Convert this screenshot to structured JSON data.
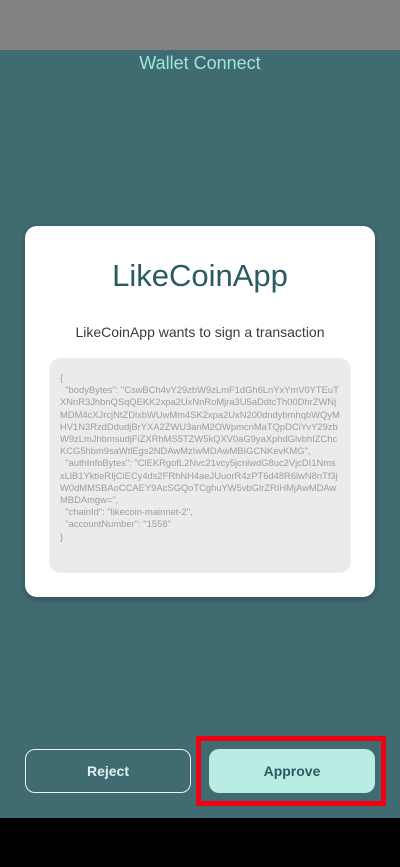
{
  "header": {
    "title": "Wallet Connect"
  },
  "card": {
    "app_name": "LikeCoinApp",
    "subtitle": "LikeCoinApp wants to sign a transaction",
    "payload": "{\n  \"bodyBytes\": \"CswBCh4vY29zbW9zLmF1dGh6LnYxYmV0YTEuTXNnR3JhbnQSqQEKK2xpa2UxNnRoMjra3U5aDdtcTh00DhrZWNjMDM4cXJrcjNtZDlxbWUwMm4SK2xpa2UxN200dndybmhqbWQyMHV1N3RzdDdudjBrYXA2ZWU3anM2OWpmcnMaTQpDCiYvY29zbW9zLmJhbmsudjFiZXRhMS5TZW5kQXV0aG9yaXphdGlvbhIZChcKCG5hbm9saWtlEgs2NDAwMzIwMDAwMBIGCNKevKMG\",\n  \"authInfoBytes\": \"ClEKRgofL2Nvc21vcy5jcnlwdG8uc2VjcDI1NmsxLlB1YktleRIjCiECy4ds2FRhNH4aeJUuorR4zPT6d48R6lwN8nTf3jW0dMMSBAoCCAEY9AcSGQoTCghuYW5vbGlrZRIHMjAwMDAwMBDAmgw=\",\n  \"chainId\": \"likecoin-mainnet-2\",\n  \"accountNumber\": \"1558\"\n}"
  },
  "actions": {
    "reject_label": "Reject",
    "approve_label": "Approve"
  },
  "colors": {
    "background": "#3f6b71",
    "accent": "#9ee6da",
    "approve_bg": "#b9ece3",
    "highlight": "#f00010"
  }
}
